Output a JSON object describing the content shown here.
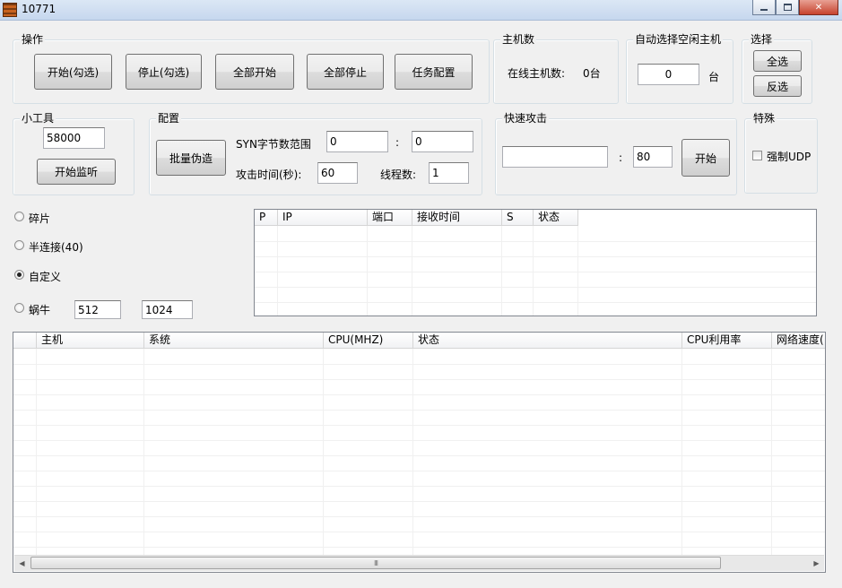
{
  "window": {
    "title": "10771"
  },
  "ops": {
    "title": "操作",
    "buttons": [
      "开始(勾选)",
      "停止(勾选)",
      "全部开始",
      "全部停止",
      "任务配置"
    ]
  },
  "hosts": {
    "title": "主机数",
    "online_label": "在线主机数:",
    "online_value": "0台"
  },
  "auto_select": {
    "title": "自动选择空闲主机",
    "value": "0",
    "unit": "台"
  },
  "select": {
    "title": "选择",
    "select_all": "全选",
    "invert": "反选"
  },
  "tools": {
    "title": "小工具",
    "port_value": "58000",
    "monitor_button": "开始监听"
  },
  "config": {
    "title": "配置",
    "batch_button": "批量伪造",
    "syn_label": "SYN字节数范围",
    "syn_min": "0",
    "syn_sep": ":",
    "syn_max": "0",
    "time_label": "攻击时间(秒):",
    "time_value": "60",
    "threads_label": "线程数:",
    "threads_value": "1"
  },
  "quick": {
    "title": "快速攻击",
    "target_value": "",
    "sep": ":",
    "port_value": "80",
    "start_button": "开始"
  },
  "special": {
    "title": "特殊",
    "force_udp": "强制UDP"
  },
  "modes": [
    {
      "label": "碎片",
      "checked": false
    },
    {
      "label": "半连接(40)",
      "checked": false
    },
    {
      "label": "自定义",
      "checked": true
    },
    {
      "label": "蜗牛",
      "checked": false
    }
  ],
  "snail": {
    "min": "512",
    "max": "1024"
  },
  "small_list": {
    "columns": [
      "P",
      "IP",
      "端口",
      "接收时间",
      "S",
      "状态"
    ],
    "rows": []
  },
  "host_list": {
    "columns": [
      "",
      "主机",
      "系统",
      "CPU(MHZ)",
      "状态",
      "CPU利用率",
      "网络速度("
    ],
    "rows": []
  },
  "scrollbar": {
    "left_arrow": "◀",
    "right_arrow": "▶",
    "grip": "III"
  }
}
